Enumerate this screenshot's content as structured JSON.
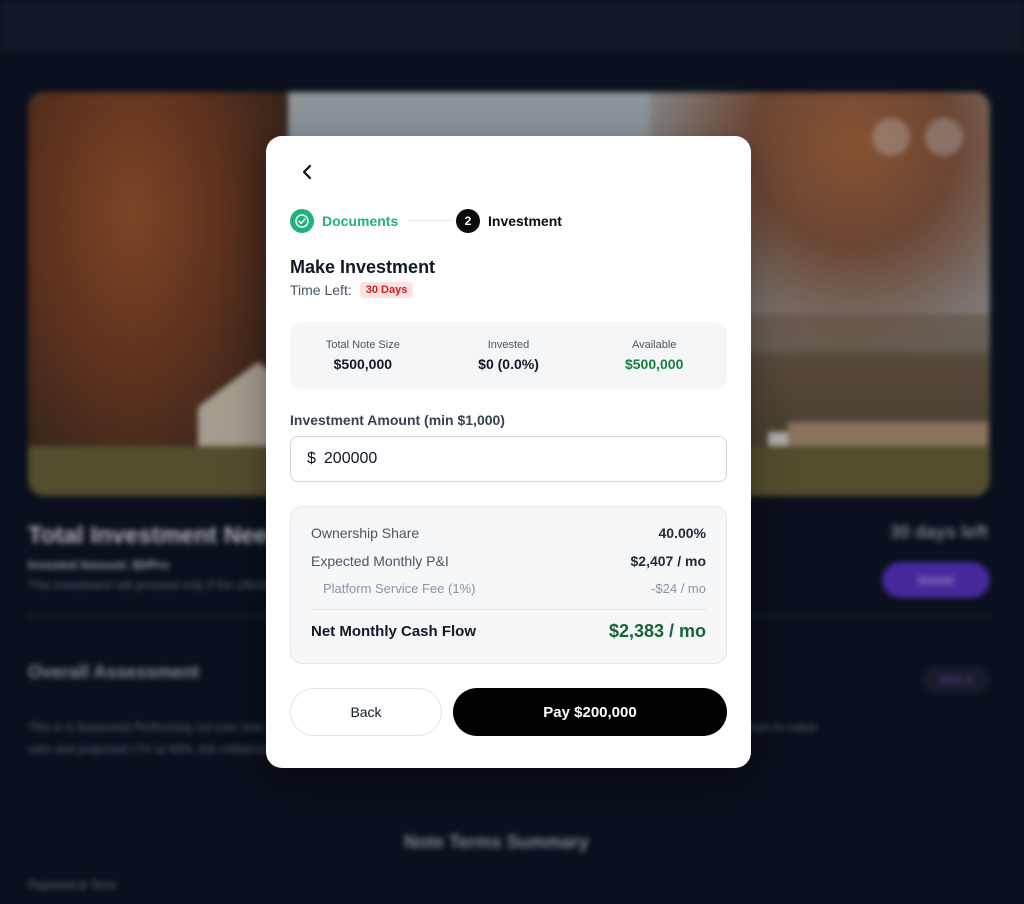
{
  "background": {
    "title": "Total Investment Needed",
    "subtitle": "Invested Amount: $0/Pro",
    "subnote": "This investment will proceed only if the offering is fully funded.",
    "days_left": "30 days left",
    "invest_label": "Invest",
    "assessment_title": "Overall Assessment",
    "rating": "95% A",
    "paragraph": "This is a Seasoned Performing 1st Lien note. The borrower has demonstrated stable payment behavior over the last 12 months. With a loan-to-value ratio and projected LTV at 40%, the collateral coverage is strong.",
    "note_terms_title": "Note Terms Summary",
    "payment_label": "Payment & Term"
  },
  "modal": {
    "steps": [
      {
        "label": "Documents",
        "status": "complete"
      },
      {
        "number": "2",
        "label": "Investment",
        "status": "active"
      }
    ],
    "title": "Make Investment",
    "time_left_label": "Time Left:",
    "time_left_value": "30 Days",
    "stats": [
      {
        "label": "Total Note Size",
        "value": "$500,000"
      },
      {
        "label": "Invested",
        "value": "$0 (0.0%)"
      },
      {
        "label": "Available",
        "value": "$500,000"
      }
    ],
    "amount_label": "Investment Amount (min $1,000)",
    "amount_prefix": "$",
    "amount_value": "200000",
    "summary": {
      "ownership_label": "Ownership Share",
      "ownership_value": "40.00%",
      "pi_label": "Expected Monthly P&I",
      "pi_value": "$2,407 / mo",
      "fee_label": "Platform Service Fee (1%)",
      "fee_value": "-$24 / mo",
      "net_label": "Net Monthly Cash Flow",
      "net_value": "$2,383 / mo"
    },
    "back_label": "Back",
    "pay_label": "Pay $200,000"
  },
  "colors": {
    "accent_green": "#1fb27a",
    "value_green": "#15803d",
    "badge_red": "#c81e1e",
    "primary_button": "#000000"
  },
  "icons": [
    "chevron-left-icon",
    "check-circle-icon",
    "share-icon",
    "heart-icon"
  ]
}
